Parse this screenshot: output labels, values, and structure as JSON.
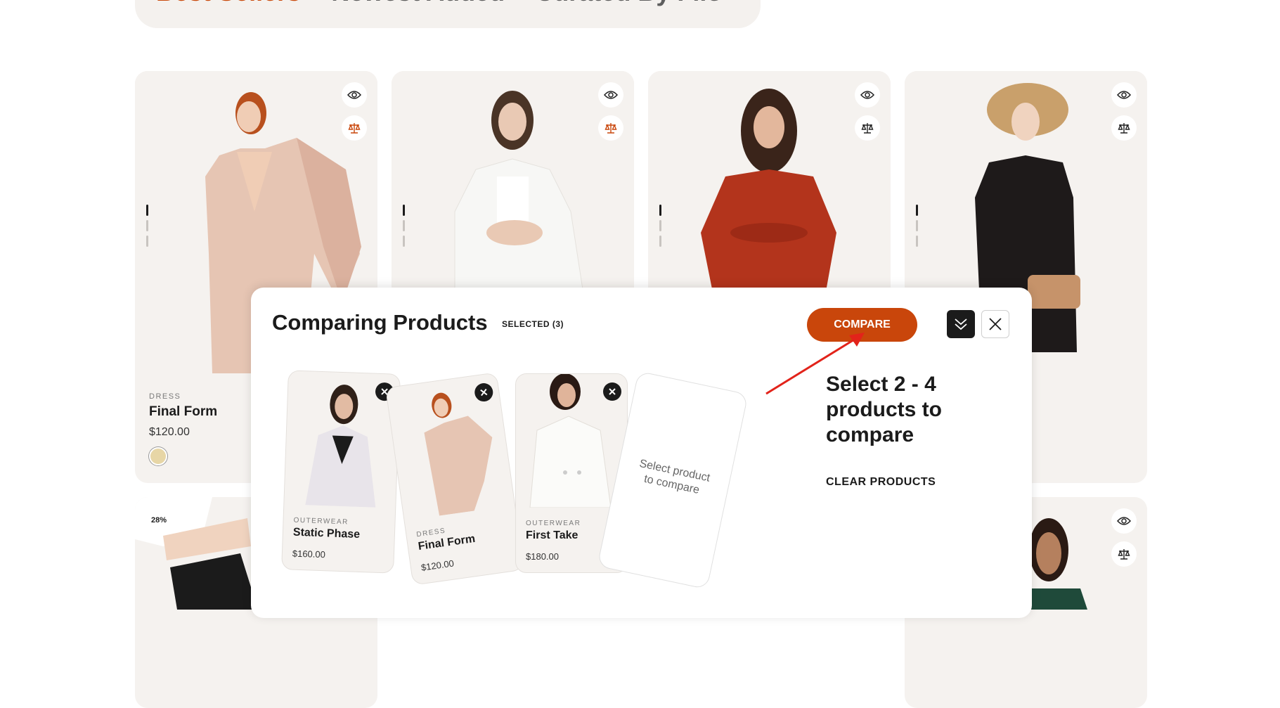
{
  "tabs": {
    "active": "Best Sellers",
    "sep": "/",
    "second": "Newest Added",
    "third": "Curated By Filo"
  },
  "cards": [
    {
      "category": "DRESS",
      "name": "Final Form",
      "price": "$120.00"
    }
  ],
  "badge": "28%",
  "panel": {
    "title": "Comparing Products",
    "selected": "SELECTED (3)",
    "compare_label": "COMPARE",
    "hint": "Select 2 - 4 products to compare",
    "clear_label": "CLEAR PRODUCTS",
    "placeholder": "Select product to compare",
    "items": [
      {
        "category": "OUTERWEAR",
        "name": "Static Phase",
        "price": "$160.00"
      },
      {
        "category": "DRESS",
        "name": "Final Form",
        "price": "$120.00"
      },
      {
        "category": "OUTERWEAR",
        "name": "First Take",
        "price": "$180.00"
      }
    ]
  },
  "colors": {
    "accent": "#c9460b",
    "card_bg": "#f5f2ef",
    "arrow": "#e2231a"
  },
  "icons": [
    "eye-icon",
    "compare-scale-icon",
    "close-icon",
    "chevron-double-down-icon"
  ]
}
